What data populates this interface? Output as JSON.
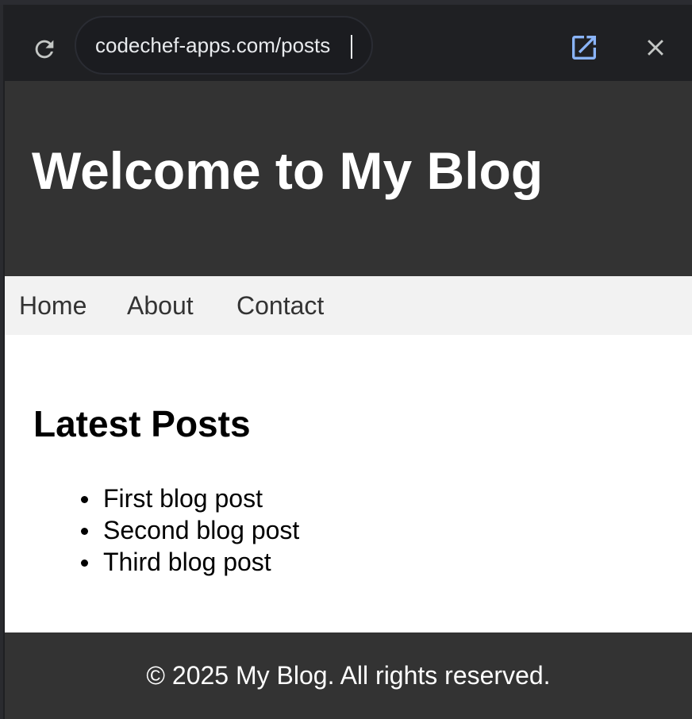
{
  "browser": {
    "url": "codechef-apps.com/posts",
    "icons": {
      "reload": "reload-icon",
      "open_external": "open-in-new-icon",
      "close": "close-icon"
    },
    "colors": {
      "toolbar_bg": "#1f2023",
      "url_text": "#e8eaed",
      "accent": "#8ab4f8"
    }
  },
  "site": {
    "title": "Welcome to My Blog",
    "nav": [
      {
        "label": "Home"
      },
      {
        "label": "About"
      },
      {
        "label": "Contact"
      }
    ],
    "section_title": "Latest Posts",
    "posts": [
      {
        "title": "First blog post"
      },
      {
        "title": "Second blog post"
      },
      {
        "title": "Third blog post"
      }
    ],
    "footer": "© 2025 My Blog. All rights reserved.",
    "colors": {
      "header_bg": "#333333",
      "nav_bg": "#f2f2f2",
      "nav_text": "#333333",
      "body_bg": "#ffffff"
    }
  }
}
